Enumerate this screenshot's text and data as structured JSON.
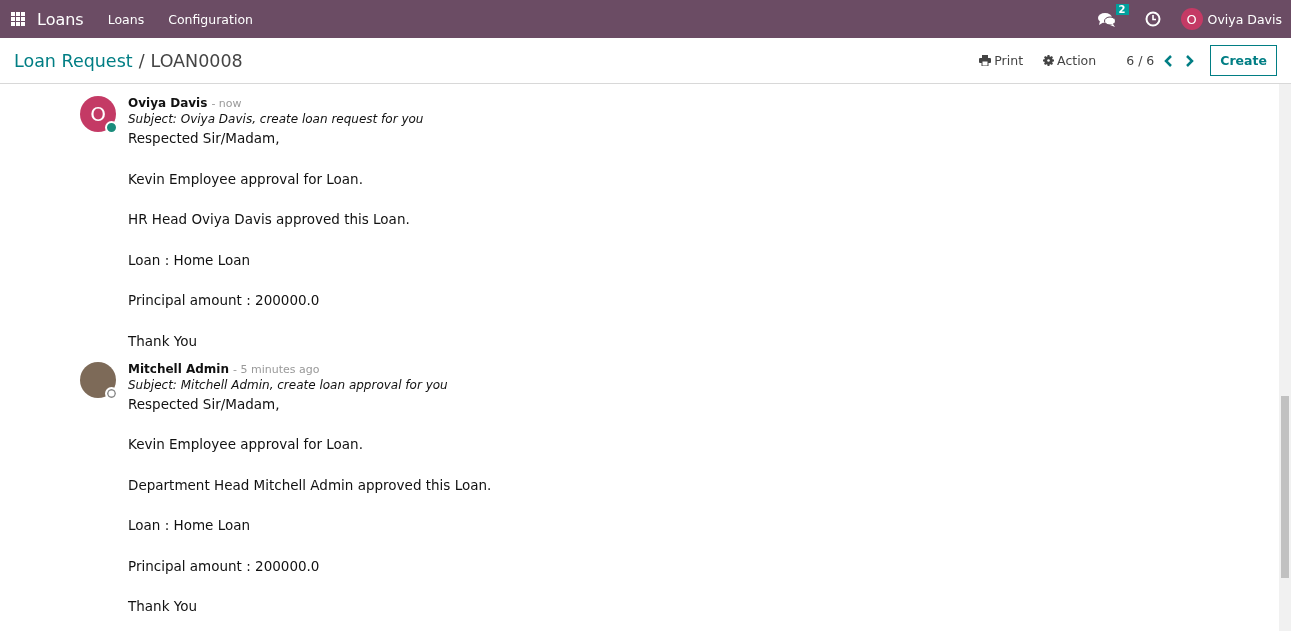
{
  "navbar": {
    "app_name": "Loans",
    "menu": [
      "Loans",
      "Configuration"
    ],
    "messages_count": "2",
    "user": {
      "initial": "O",
      "name": "Oviya Davis"
    }
  },
  "control_panel": {
    "breadcrumb": {
      "parent": "Loan Request",
      "separator": "/",
      "current": "LOAN0008"
    },
    "actions": [
      "Print",
      "Action"
    ],
    "pager": "6 / 6",
    "create_button": "Create"
  },
  "messages": [
    {
      "author": "Oviya Davis",
      "time": "- now",
      "kind": "letter",
      "avatar_initial": "O",
      "online": true,
      "subject": "Subject: Oviya Davis, create loan request for you",
      "paragraphs": [
        "Respected Sir/Madam,",
        "Kevin Employee approval for Loan.",
        "HR Head Oviya Davis approved this Loan.",
        "Loan : Home Loan",
        "Principal amount : 200000.0",
        "Thank You"
      ]
    },
    {
      "author": "Mitchell Admin",
      "time": "- 5 minutes ago",
      "kind": "photo",
      "online": false,
      "subject": "Subject: Mitchell Admin, create loan approval for you",
      "paragraphs": [
        "Respected Sir/Madam,",
        "Kevin Employee approval for Loan.",
        "Department Head Mitchell Admin approved this Loan.",
        "Loan : Home Loan",
        "Principal amount : 200000.0",
        "Thank You"
      ]
    }
  ]
}
